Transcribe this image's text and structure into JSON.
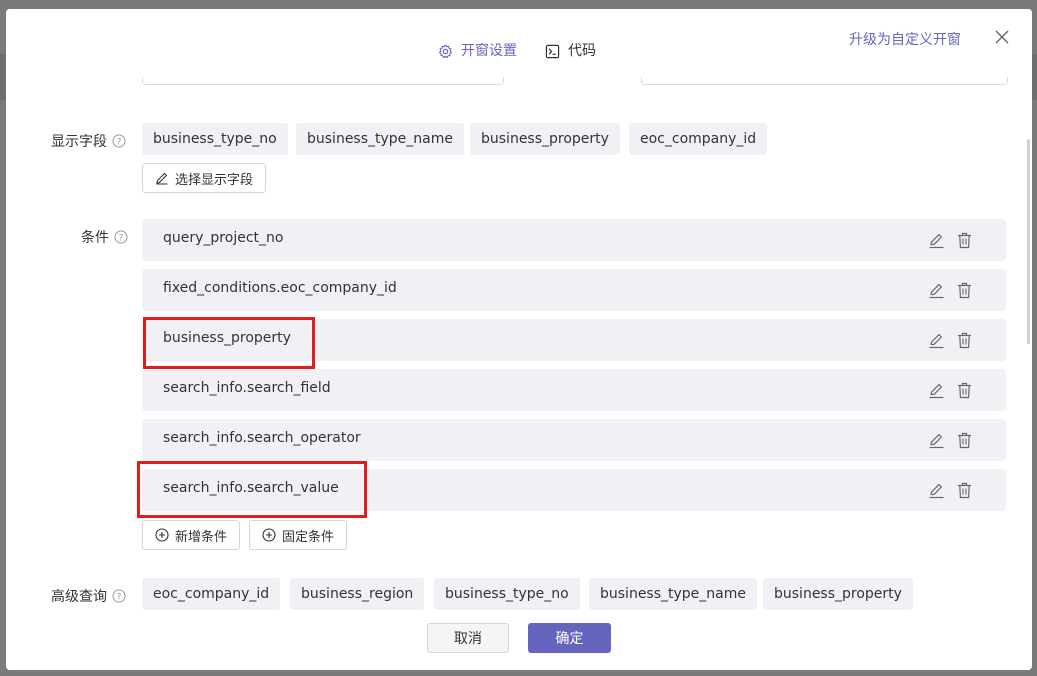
{
  "header": {
    "tabs": [
      {
        "label": "开窗设置",
        "icon": "gear-icon",
        "active": true
      },
      {
        "label": "代码",
        "icon": "terminal-icon",
        "active": false
      }
    ],
    "upgrade_link": "升级为自定义开窗",
    "close_icon": "close-icon"
  },
  "colors": {
    "accent": "#6665bd",
    "chip_bg": "#f1f1f5",
    "highlight": "#e21b1b"
  },
  "display_fields": {
    "label": "显示字段",
    "chips": [
      "business_type_no",
      "business_type_name",
      "business_property",
      "eoc_company_id"
    ],
    "select_button": "选择显示字段"
  },
  "conditions": {
    "label": "条件",
    "rows": [
      "query_project_no",
      "fixed_conditions.eoc_company_id",
      "business_property",
      "search_info.search_field",
      "search_info.search_operator",
      "search_info.search_value"
    ],
    "highlighted": [
      "business_property",
      "search_info.search_value"
    ],
    "add_button": "新增条件",
    "fixed_button": "固定条件"
  },
  "advanced_query": {
    "label": "高级查询",
    "chips": [
      "eoc_company_id",
      "business_region",
      "business_type_no",
      "business_type_name",
      "business_property"
    ]
  },
  "footer": {
    "cancel": "取消",
    "confirm": "确定"
  }
}
